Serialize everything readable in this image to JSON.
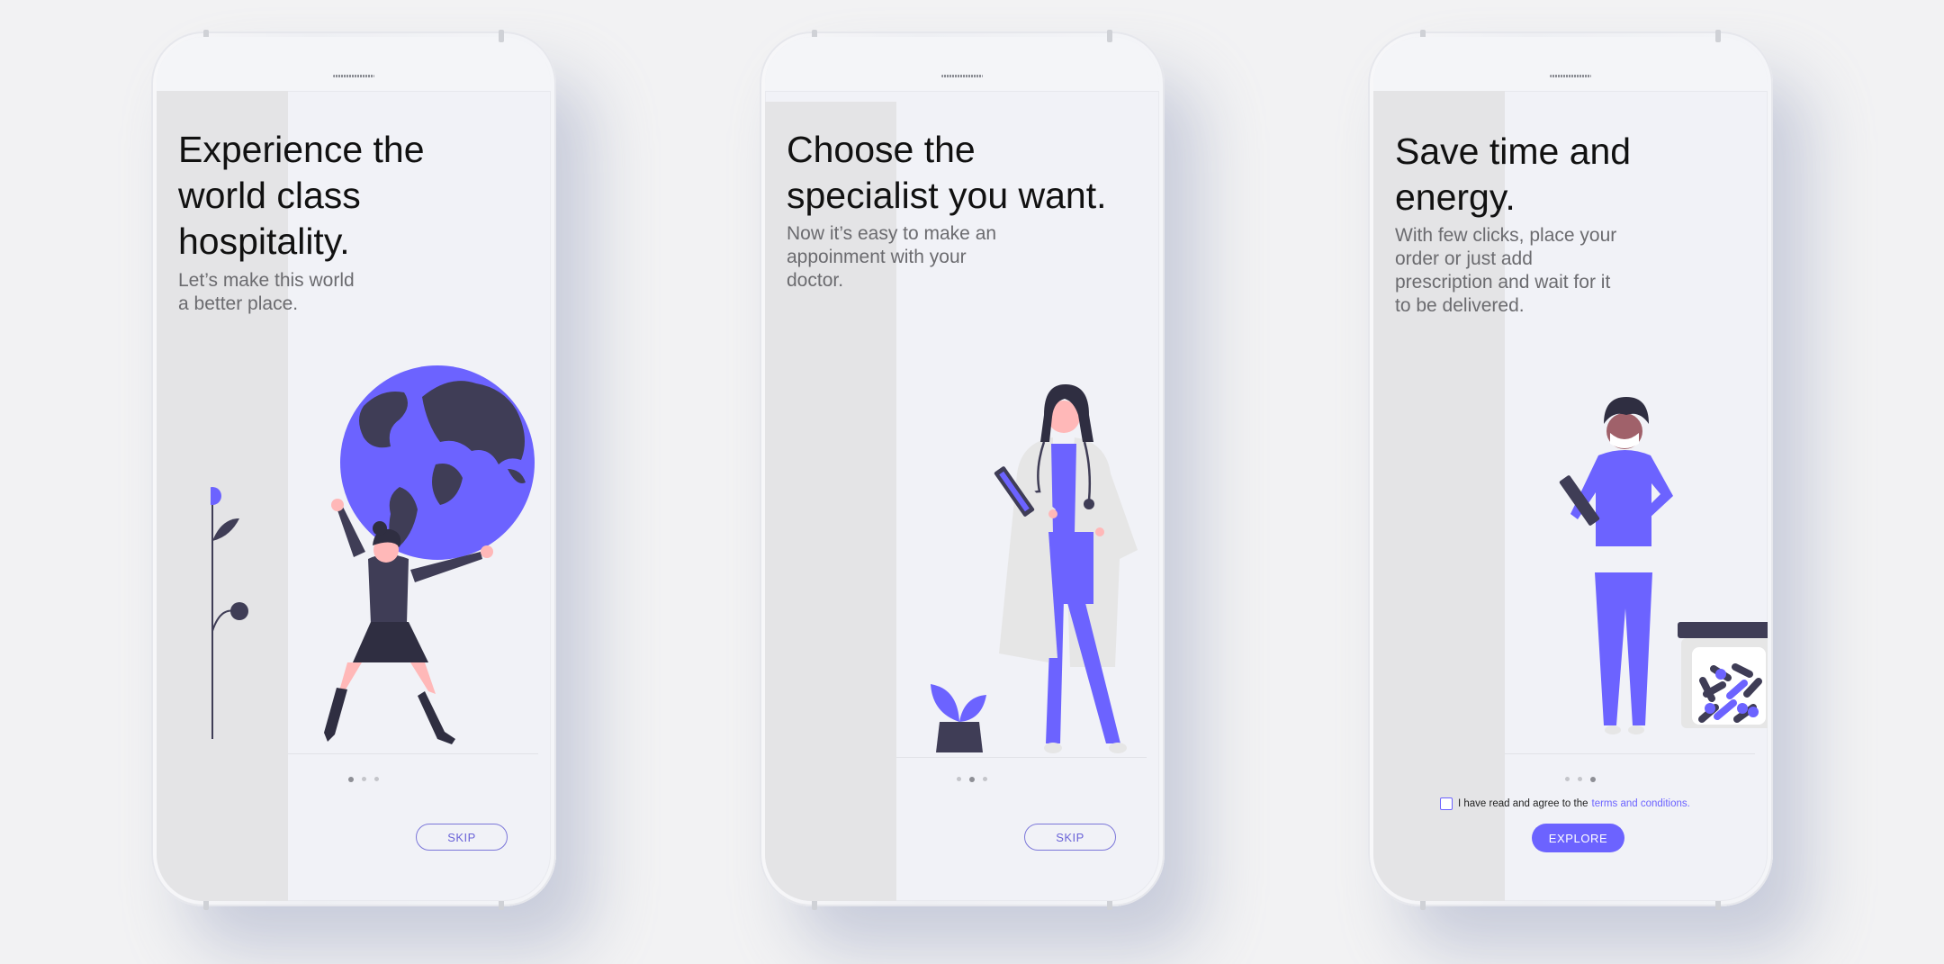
{
  "colors": {
    "accent": "#6c63ff",
    "dark": "#3f3d56",
    "skin": "#ffb8b8",
    "background": "#f2f2f3"
  },
  "screens": [
    {
      "title_lines": [
        "Experience the",
        "world class",
        "hospitality."
      ],
      "subtitle_lines": [
        "Let’s make this world",
        "a better place."
      ],
      "illustration": "woman-carrying-globe-illustration",
      "page_index": 1,
      "button_label": "SKIP"
    },
    {
      "title_lines": [
        "Choose the",
        "specialist you want."
      ],
      "subtitle_lines": [
        "Now it’s easy to make an",
        "appoinment with your",
        "doctor."
      ],
      "illustration": "doctor-with-stethoscope-illustration",
      "page_index": 2,
      "button_label": "SKIP"
    },
    {
      "title_lines": [
        "Save time and",
        "energy."
      ],
      "subtitle_lines": [
        "With few clicks, place your",
        "order or just add",
        "prescription and wait for it",
        "to be delivered."
      ],
      "illustration": "nurse-with-pill-jar-illustration",
      "page_index": 3,
      "agree_text": "I have read and agree to the",
      "agree_link": "terms and conditions.",
      "button_label": "EXPLORE"
    }
  ]
}
